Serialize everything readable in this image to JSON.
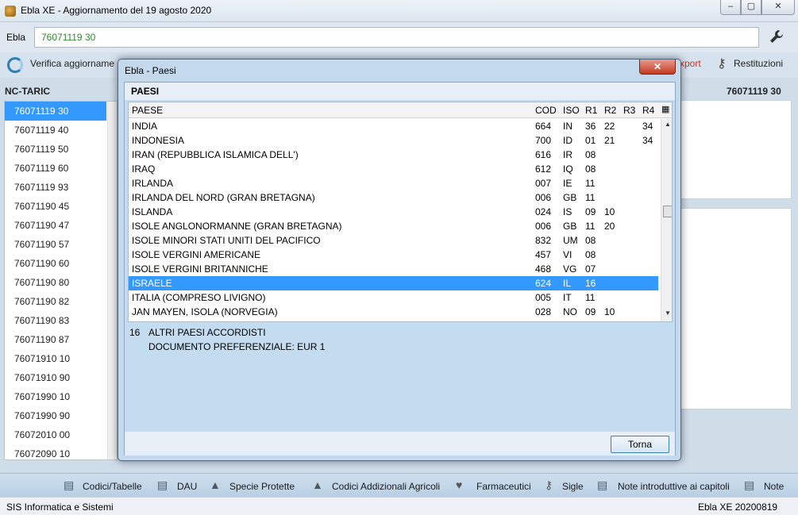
{
  "window": {
    "title": "Ebla XE - Aggiornamento del 19 agosto 2020",
    "min_glyph": "–",
    "max_glyph": "▢",
    "close_glyph": "✕"
  },
  "search": {
    "label": "Ebla",
    "value": "76071119 30"
  },
  "toolbar": {
    "verify_label": "Verifica aggiorname",
    "export_label": "xport",
    "restituzioni_label": "Restituzioni"
  },
  "left_panel": {
    "title": "NC-TARIC",
    "items": [
      "76071119 30",
      "76071119 40",
      "76071119 50",
      "76071119 60",
      "76071119 93",
      "76071190 45",
      "76071190 47",
      "76071190 57",
      "76071190 60",
      "76071190 80",
      "76071190 82",
      "76071190 83",
      "76071190 87",
      "76071910 10",
      "76071910 90",
      "76071990 10",
      "76071990 90",
      "76072010 00",
      "76072090 10"
    ],
    "selected_index": 0
  },
  "right_panel": {
    "code": "76071119 30"
  },
  "dialog": {
    "title": "Ebla - Paesi",
    "close_glyph": "✕",
    "section_title": "PAESI",
    "columns": [
      "PAESE",
      "COD",
      "ISO",
      "R1",
      "R2",
      "R3",
      "R4"
    ],
    "rows": [
      {
        "paese": "INDIA",
        "cod": "664",
        "iso": "IN",
        "r1": "36",
        "r2": "22",
        "r3": "",
        "r4": "34"
      },
      {
        "paese": "INDONESIA",
        "cod": "700",
        "iso": "ID",
        "r1": "01",
        "r2": "21",
        "r3": "",
        "r4": "34"
      },
      {
        "paese": "IRAN (REPUBBLICA ISLAMICA DELL')",
        "cod": "616",
        "iso": "IR",
        "r1": "08",
        "r2": "",
        "r3": "",
        "r4": ""
      },
      {
        "paese": "IRAQ",
        "cod": "612",
        "iso": "IQ",
        "r1": "08",
        "r2": "",
        "r3": "",
        "r4": ""
      },
      {
        "paese": "IRLANDA",
        "cod": "007",
        "iso": "IE",
        "r1": "11",
        "r2": "",
        "r3": "",
        "r4": ""
      },
      {
        "paese": "IRLANDA DEL NORD   (GRAN BRETAGNA)",
        "cod": "006",
        "iso": "GB",
        "r1": "11",
        "r2": "",
        "r3": "",
        "r4": ""
      },
      {
        "paese": "ISLANDA",
        "cod": "024",
        "iso": "IS",
        "r1": "09",
        "r2": "10",
        "r3": "",
        "r4": ""
      },
      {
        "paese": "ISOLE ANGLONORMANNE (GRAN BRETAGNA)",
        "cod": "006",
        "iso": "GB",
        "r1": "11",
        "r2": "20",
        "r3": "",
        "r4": ""
      },
      {
        "paese": "ISOLE MINORI STATI UNITI DEL PACIFICO",
        "cod": "832",
        "iso": "UM",
        "r1": "08",
        "r2": "",
        "r3": "",
        "r4": ""
      },
      {
        "paese": "ISOLE VERGINI AMERICANE",
        "cod": "457",
        "iso": "VI",
        "r1": "08",
        "r2": "",
        "r3": "",
        "r4": ""
      },
      {
        "paese": "ISOLE VERGINI BRITANNICHE",
        "cod": "468",
        "iso": "VG",
        "r1": "07",
        "r2": "",
        "r3": "",
        "r4": ""
      },
      {
        "paese": "ISRAELE",
        "cod": "624",
        "iso": "IL",
        "r1": "16",
        "r2": "",
        "r3": "",
        "r4": ""
      },
      {
        "paese": "ITALIA (COMPRESO LIVIGNO)",
        "cod": "005",
        "iso": "IT",
        "r1": "11",
        "r2": "",
        "r3": "",
        "r4": ""
      },
      {
        "paese": "JAN MAYEN, ISOLA  (NORVEGIA)",
        "cod": "028",
        "iso": "NO",
        "r1": "09",
        "r2": "10",
        "r3": "",
        "r4": ""
      }
    ],
    "selected_index": 11,
    "detail": {
      "number": "16",
      "line1": "ALTRI PAESI ACCORDISTI",
      "line2": "DOCUMENTO PREFERENZIALE: EUR 1"
    },
    "torna_label": "Torna"
  },
  "bottom_toolbar": {
    "items": [
      "Codici/Tabelle",
      "DAU",
      "Specie Protette",
      "Codici Addizionali Agricoli",
      "Farmaceutici",
      "Sigle",
      "Note introduttive ai capitoli",
      "Note"
    ]
  },
  "status": {
    "left": "SIS Informatica e Sistemi",
    "right": "Ebla XE 20200819"
  }
}
